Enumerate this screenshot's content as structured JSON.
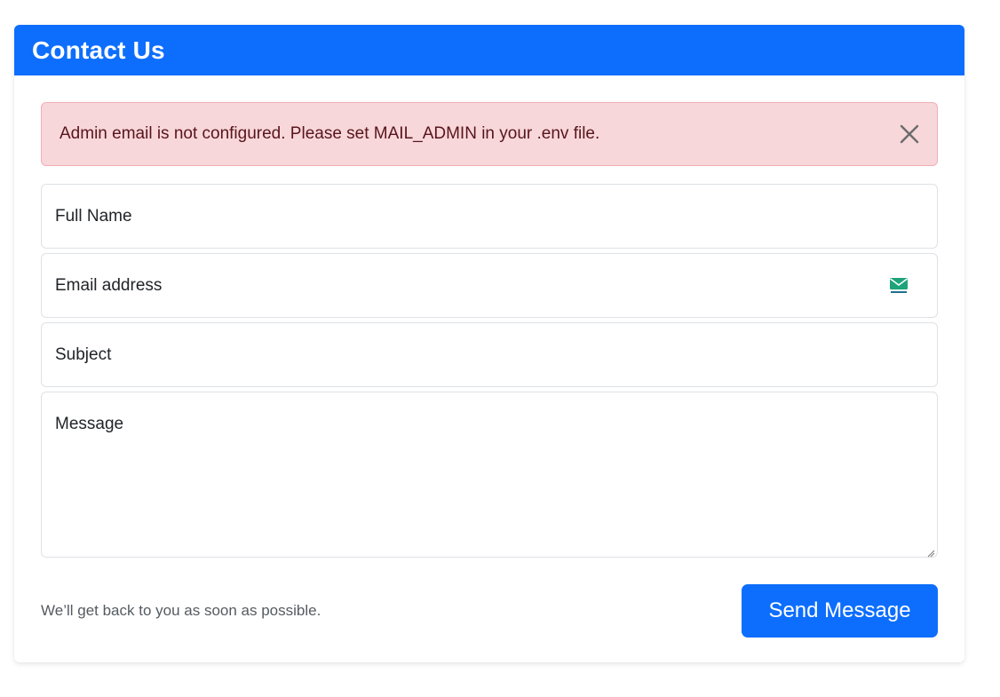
{
  "header": {
    "title": "Contact Us"
  },
  "alert": {
    "message": "Admin email is not configured. Please set MAIL_ADMIN in your .env file.",
    "close_icon": "close-icon"
  },
  "form": {
    "full_name": {
      "placeholder": "Full Name",
      "value": ""
    },
    "email": {
      "placeholder": "Email address",
      "value": "",
      "icon": "temp-mail-icon"
    },
    "subject": {
      "placeholder": "Subject",
      "value": ""
    },
    "message": {
      "placeholder": "Message",
      "value": ""
    }
  },
  "footer": {
    "help_text": "We’ll get back to you as soon as possible.",
    "send_label": "Send Message"
  },
  "colors": {
    "primary": "#0d6efd",
    "alert_bg": "#f8d7da",
    "alert_text": "#58151c",
    "border": "#dee2e6"
  }
}
